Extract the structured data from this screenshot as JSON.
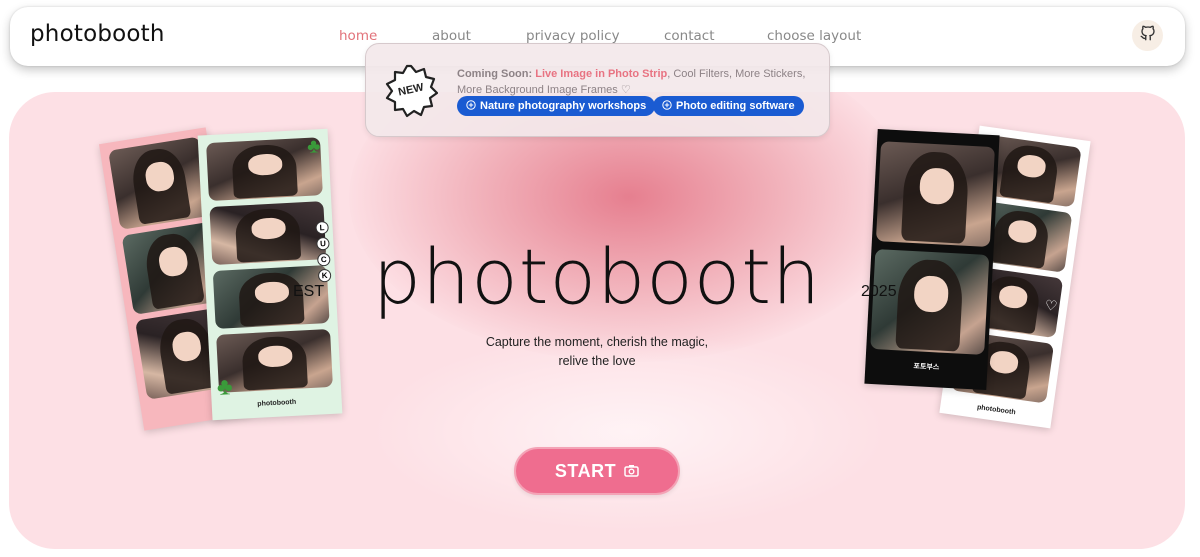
{
  "nav": {
    "brand": "photobooth",
    "links": [
      {
        "label": "home",
        "active": true
      },
      {
        "label": "about",
        "active": false
      },
      {
        "label": "privacy policy",
        "active": false
      },
      {
        "label": "contact",
        "active": false
      },
      {
        "label": "choose layout",
        "active": false
      }
    ],
    "github_icon": "github-icon"
  },
  "announcement": {
    "badge": "NEW",
    "lead": "Coming Soon:",
    "highlight": "Live Image in Photo Strip",
    "rest": ", Cool Filters, More Stickers, More Background Image Frames ♡",
    "chips": [
      "Nature photography workshops",
      "Photo editing software"
    ]
  },
  "hero": {
    "title": "photobooth",
    "tagline_line1": "Capture the moment, cherish the magic,",
    "tagline_line2": "relive the love",
    "est": "EST",
    "year": "2025",
    "start_label": "START",
    "camera_icon": "camera-icon"
  },
  "strips": {
    "left_back_caption": "",
    "left_front_caption": "photobooth",
    "luck_letters": [
      "L",
      "U",
      "C",
      "K"
    ],
    "right_back_caption": "photobooth",
    "right_front_caption": "포토부스"
  },
  "colors": {
    "accent": "#e2727a",
    "hero_bg": "#fde0e5",
    "start_button": "#ef6d8f",
    "chip": "#1a5bd2"
  }
}
